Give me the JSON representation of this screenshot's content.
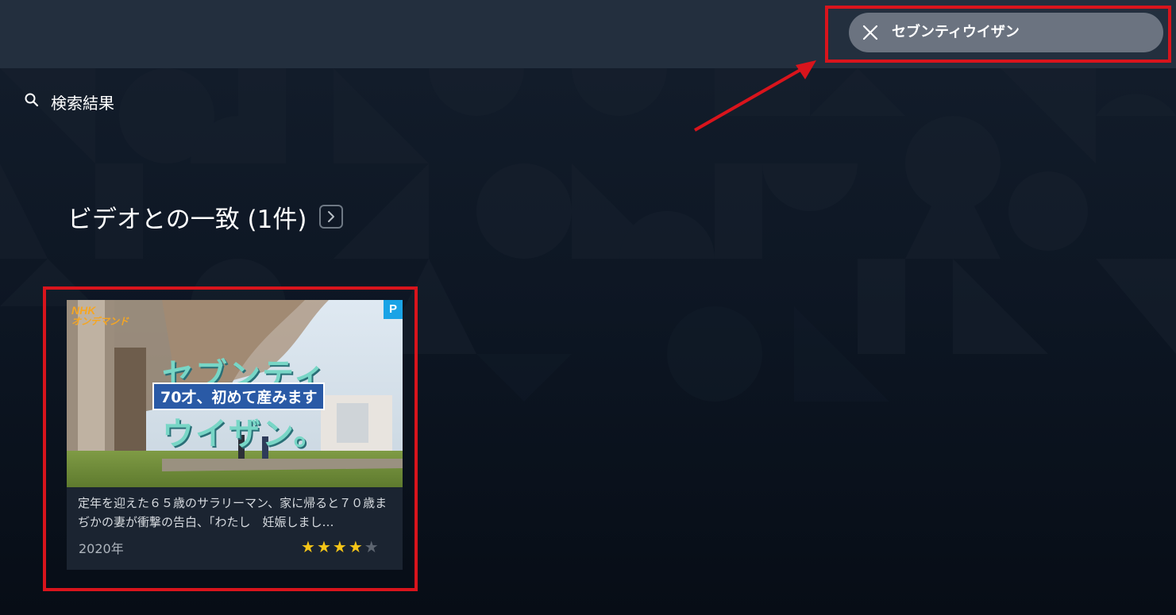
{
  "search": {
    "query": "セブンティウイザン",
    "close_icon": "close-icon"
  },
  "results_header": {
    "icon": "search-icon",
    "label": "検索結果"
  },
  "section": {
    "title": "ビデオとの一致 (1件)",
    "chevron_icon": "chevron-right-icon"
  },
  "card": {
    "logo_line1": "NHK",
    "logo_line2": "オンデマンド",
    "badge": "P",
    "art_title_top": "セブンティ",
    "art_subtitle": "70才、初めて産みます",
    "art_title_bottom": "ウイザン。",
    "description": "定年を迎えた６５歳のサラリーマン、家に帰ると７０歳まぢかの妻が衝撃の告白、「わたし　妊娠しまし…",
    "year": "2020年",
    "rating": 4,
    "rating_max": 5
  },
  "colors": {
    "highlight_red": "#d9141c",
    "prime_blue": "#1aa3e6",
    "star_gold": "#f5c518"
  }
}
